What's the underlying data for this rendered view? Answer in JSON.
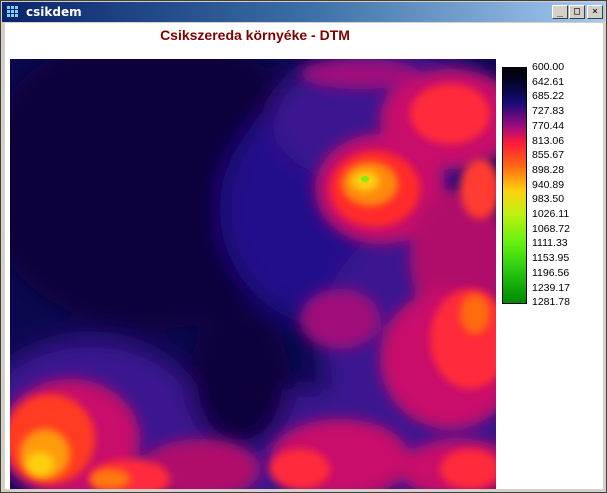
{
  "window": {
    "title": "csikdem"
  },
  "controls": {
    "minimize": "_",
    "maximize": "□",
    "close": "×"
  },
  "map": {
    "title": "Csikszereda környéke - DTM"
  },
  "legend": {
    "values": [
      "600.00",
      "642.61",
      "685.22",
      "727.83",
      "770.44",
      "813.06",
      "855.67",
      "898.28",
      "940.89",
      "983.50",
      "1026.11",
      "1068.72",
      "1111.33",
      "1153.95",
      "1196.56",
      "1239.17",
      "1281.78"
    ],
    "colors": [
      "#000000",
      "#06063a",
      "#1a0a7a",
      "#5a0a8a",
      "#c8106a",
      "#ff1a3a",
      "#ff3a1a",
      "#ff6a10",
      "#ff9a10",
      "#ffd010",
      "#f0f010",
      "#b0f010",
      "#70f010",
      "#40e010",
      "#20c010",
      "#10a010",
      "#008a00"
    ]
  }
}
